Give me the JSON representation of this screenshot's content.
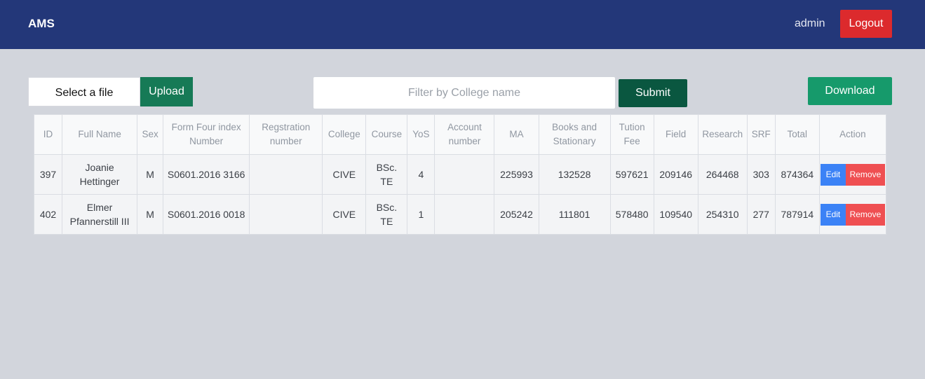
{
  "header": {
    "brand": "AMS",
    "username": "admin",
    "logout_label": "Logout"
  },
  "toolbar": {
    "file_select_label": "Select a file",
    "upload_label": "Upload",
    "filter_placeholder": "Filter by College name",
    "filter_value": "",
    "submit_label": "Submit",
    "download_label": "Download"
  },
  "table": {
    "columns": [
      "ID",
      "Full Name",
      "Sex",
      "Form Four index Number",
      "Regstration number",
      "College",
      "Course",
      "YoS",
      "Account number",
      "MA",
      "Books and Stationary",
      "Tution Fee",
      "Field",
      "Research",
      "SRF",
      "Total",
      "Action"
    ],
    "rows": [
      {
        "id": "397",
        "full_name": "Joanie Hettinger",
        "sex": "M",
        "form_four_index": "S0601.2016 3166",
        "registration_number": "",
        "college": "CIVE",
        "course": "BSc. TE",
        "yos": "4",
        "account_number": "",
        "ma": "225993",
        "books": "132528",
        "tuition": "597621",
        "field": "209146",
        "research": "264468",
        "srf": "303",
        "total": "874364",
        "edit_label": "Edit",
        "remove_label": "Remove"
      },
      {
        "id": "402",
        "full_name": "Elmer Pfannerstill III",
        "sex": "M",
        "form_four_index": "S0601.2016 0018",
        "registration_number": "",
        "college": "CIVE",
        "course": "BSc. TE",
        "yos": "1",
        "account_number": "",
        "ma": "205242",
        "books": "111801",
        "tuition": "578480",
        "field": "109540",
        "research": "254310",
        "srf": "277",
        "total": "787914",
        "edit_label": "Edit",
        "remove_label": "Remove"
      }
    ]
  },
  "colors": {
    "navbar": "#233779",
    "background": "#d2d5dc",
    "logout": "#dc2a2d",
    "upload": "#167a56",
    "submit": "#0a5740",
    "download": "#169a6b",
    "edit": "#3b82f6",
    "remove": "#ef4f52"
  }
}
